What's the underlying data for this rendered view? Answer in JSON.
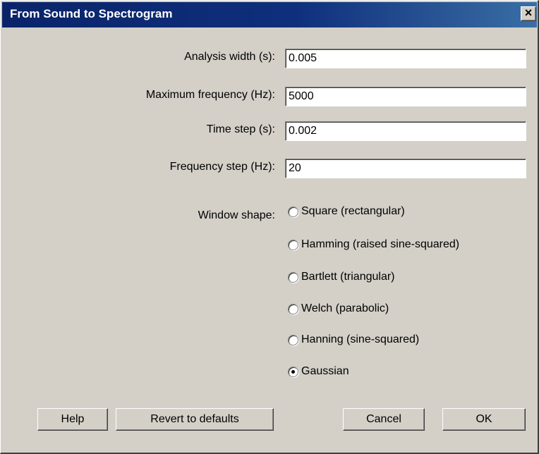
{
  "window": {
    "title": "From Sound to Spectrogram",
    "close_glyph": "✕"
  },
  "fields": [
    {
      "label": "Analysis width (s):",
      "value": "0.005"
    },
    {
      "label": "Maximum frequency (Hz):",
      "value": "5000"
    },
    {
      "label": "Time step (s):",
      "value": "0.002"
    },
    {
      "label": "Frequency step (Hz):",
      "value": "20"
    }
  ],
  "window_shape": {
    "label": "Window shape:",
    "selected": "Gaussian",
    "options": [
      "Square (rectangular)",
      "Hamming (raised sine-squared)",
      "Bartlett (triangular)",
      "Welch (parabolic)",
      "Hanning (sine-squared)",
      "Gaussian"
    ]
  },
  "buttons": {
    "help": "Help",
    "revert": "Revert to defaults",
    "cancel": "Cancel",
    "ok": "OK"
  }
}
